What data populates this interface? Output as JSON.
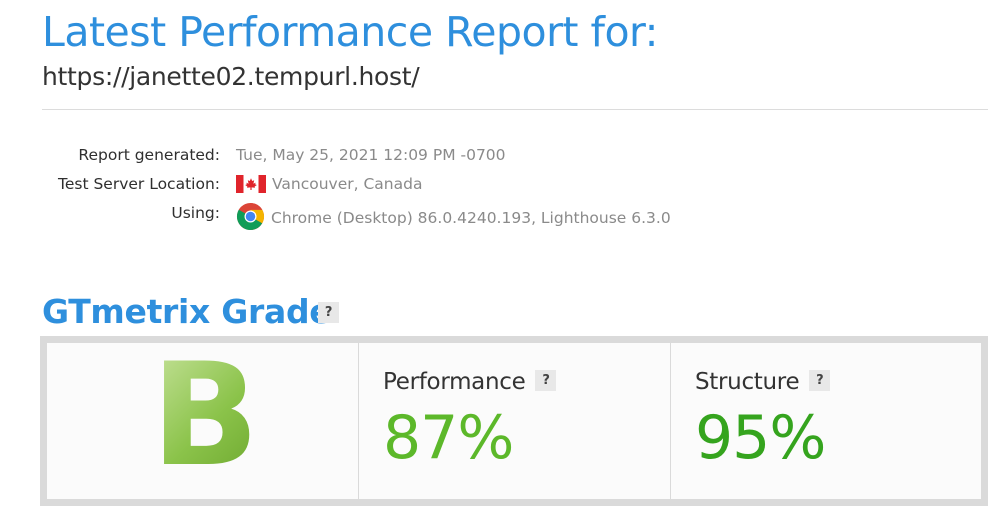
{
  "header": {
    "title": "Latest Performance Report for:",
    "url": "https://janette02.tempurl.host/"
  },
  "meta": {
    "report_generated_label": "Report generated:",
    "report_generated_value": "Tue, May 25, 2021 12:09 PM -0700",
    "location_label": "Test Server Location:",
    "location_value": "Vancouver, Canada",
    "location_icon": "canada-flag-icon",
    "using_label": "Using:",
    "using_value": "Chrome (Desktop) 86.0.4240.193, Lighthouse 6.3.0",
    "using_icon": "chrome-icon"
  },
  "grade": {
    "heading": "GTmetrix Grade",
    "help_label": "?",
    "letter": "B",
    "performance_label": "Performance",
    "performance_value": "87%",
    "structure_label": "Structure",
    "structure_value": "95%"
  },
  "colors": {
    "accent": "#2e8fdd",
    "grade_green": "#8bc34a",
    "performance_green": "#5cb82a",
    "structure_green": "#35a41e"
  }
}
